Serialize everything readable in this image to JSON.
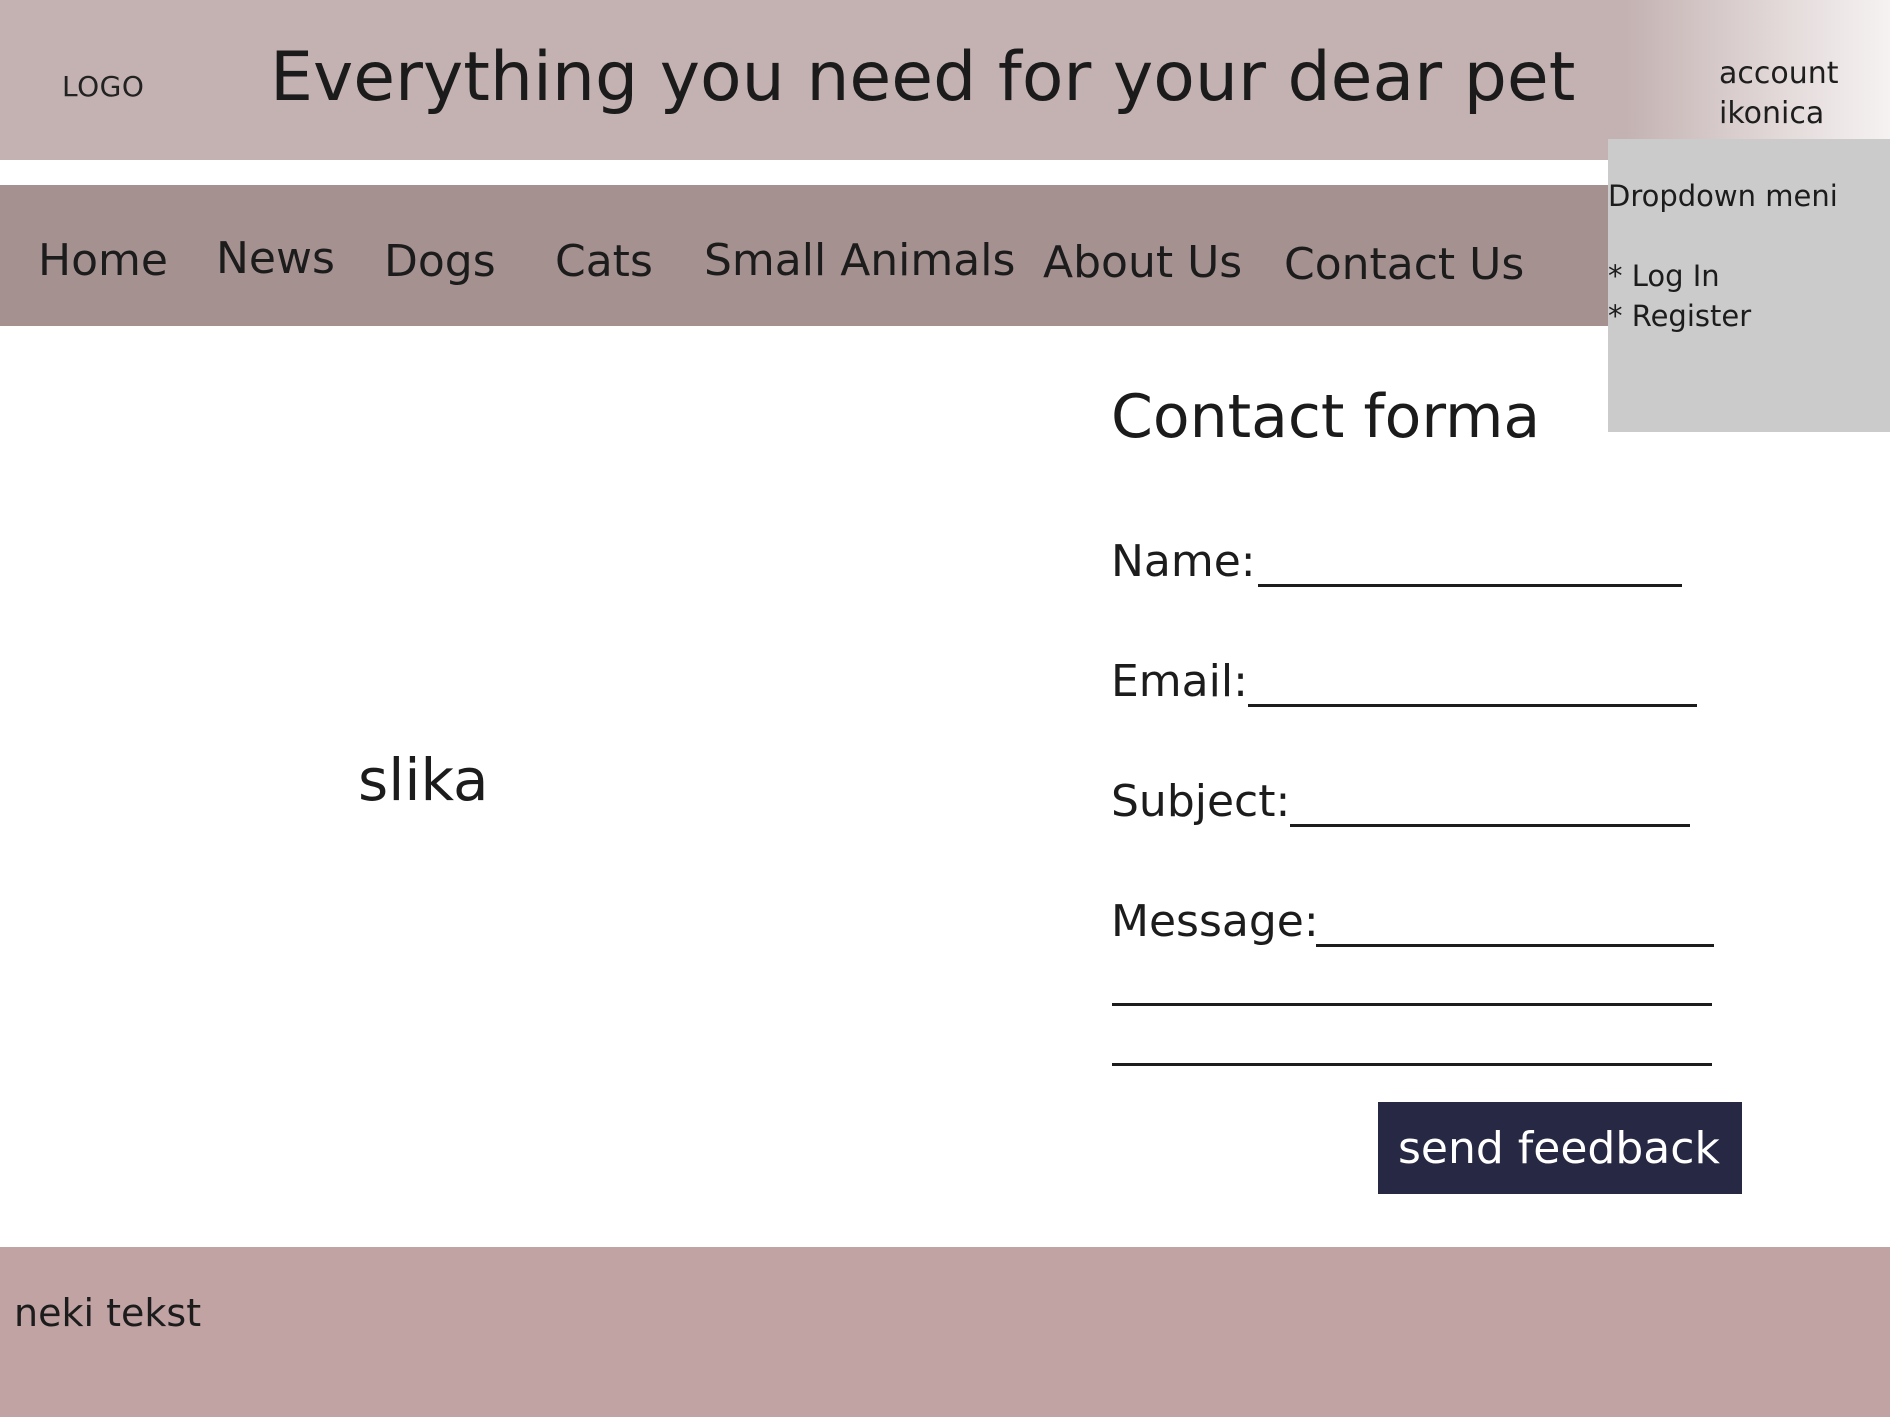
{
  "header": {
    "logo": "LOGO",
    "title": "Everything you need for your dear pet",
    "account_line1": "account",
    "account_line2": "ikonica"
  },
  "nav": {
    "items": [
      {
        "label": "Home"
      },
      {
        "label": "News"
      },
      {
        "label": "Dogs"
      },
      {
        "label": "Cats"
      },
      {
        "label": "Small Animals"
      },
      {
        "label": "About Us"
      },
      {
        "label": "Contact Us"
      }
    ]
  },
  "dropdown": {
    "title": "Dropdown meni",
    "items": [
      {
        "label": "* Log In"
      },
      {
        "label": "* Register"
      }
    ]
  },
  "main": {
    "image_label": "slika"
  },
  "form": {
    "title": "Contact forma",
    "name_label": "Name:",
    "email_label": "Email:",
    "subject_label": "Subject:",
    "message_label": "Message:",
    "submit_label": "send feedback"
  },
  "footer": {
    "text": "neki tekst"
  },
  "colors": {
    "header_bg": "#c4b2b2",
    "nav_bg": "#a69191",
    "dropdown_bg": "#cbcbcb",
    "button_bg": "#272843",
    "footer_bg": "#c1a3a4"
  }
}
